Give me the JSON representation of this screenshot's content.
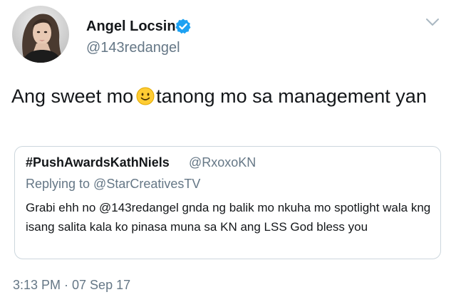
{
  "author": {
    "name": "Angel Locsin",
    "handle": "@143redangel",
    "verified": true
  },
  "tweet": {
    "text_before_emoji": "Ang sweet mo",
    "emoji": "smiley-face",
    "text_after_emoji": "tanong mo sa management yan"
  },
  "quoted_tweet": {
    "name": "#PushAwardsKathNiels",
    "handle": "@RxoxoKN",
    "replying_to": "Replying to @StarCreativesTV",
    "text": "Grabi ehh no @143redangel  gnda ng balik mo nkuha mo spotlight  wala kng isang salita kala ko pinasa muna sa KN ang LSS God bless you"
  },
  "timestamp": "3:13 PM · 07 Sep 17",
  "colors": {
    "text_primary": "#14171a",
    "text_secondary": "#657786",
    "verified_blue": "#1da1f2",
    "border": "#ccd6dd"
  },
  "icons": {
    "verified": "verified-badge-icon",
    "caret": "chevron-down-icon",
    "emoji": "smiley-emoji-icon"
  }
}
